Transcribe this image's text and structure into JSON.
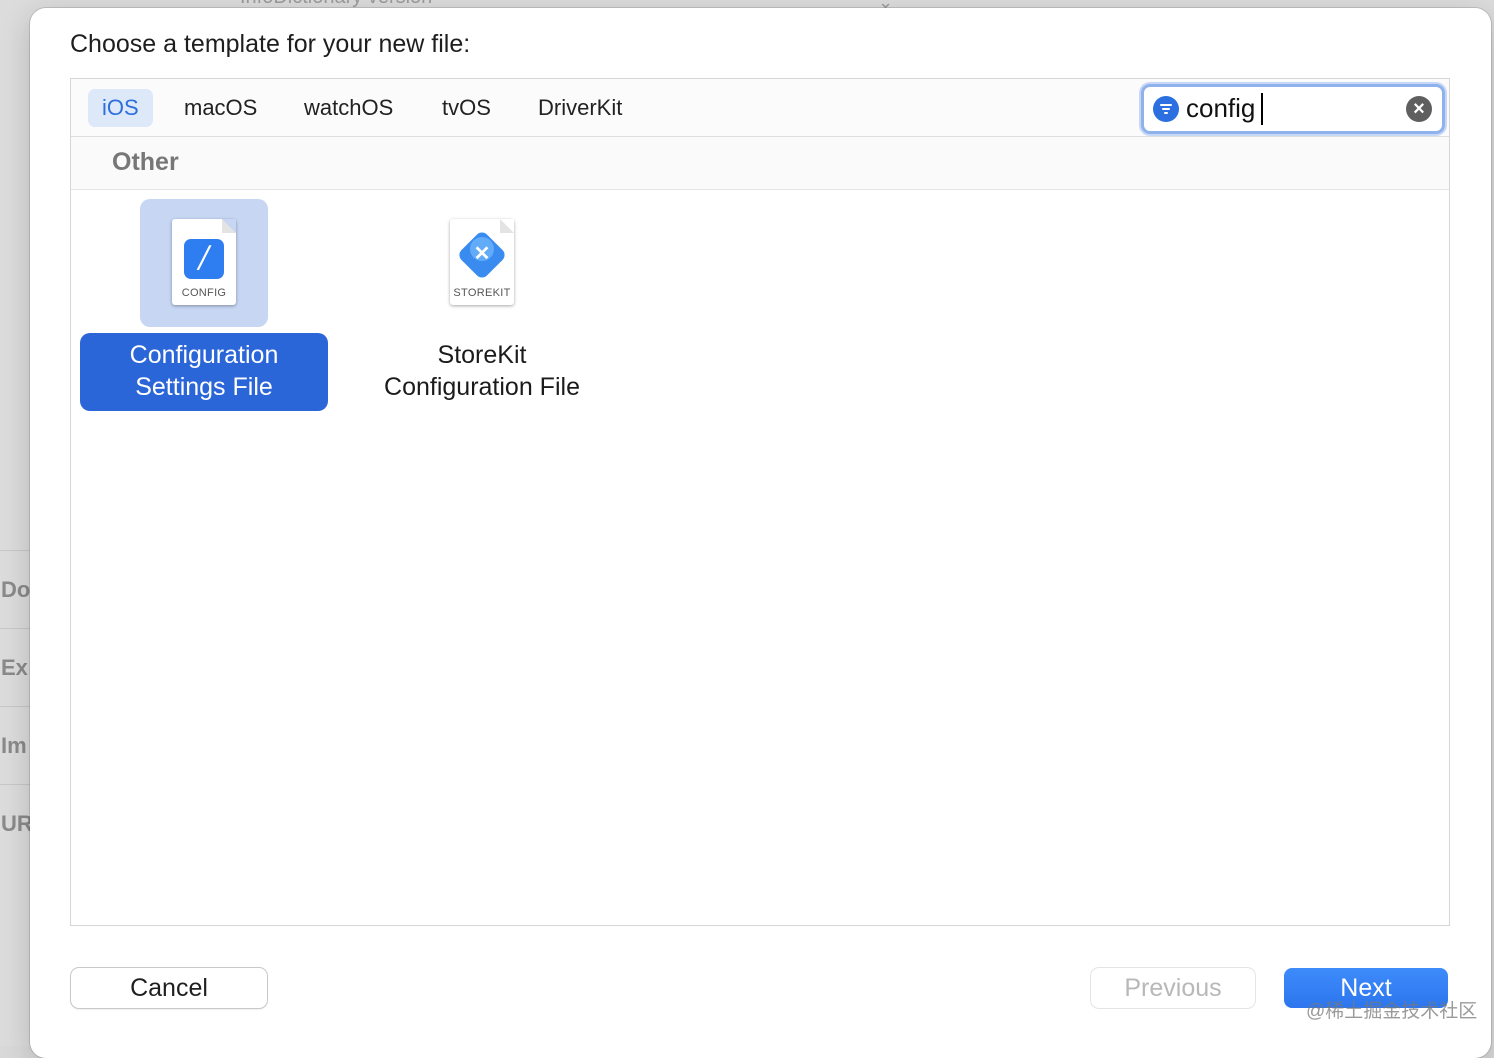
{
  "background": {
    "top_text": "InfoDictionary version",
    "sidebar_items": [
      "Do",
      "Ex",
      "Im",
      "UR"
    ]
  },
  "dialog": {
    "title": "Choose a template for your new file:",
    "platform_tabs": [
      {
        "label": "iOS",
        "selected": true
      },
      {
        "label": "macOS",
        "selected": false
      },
      {
        "label": "watchOS",
        "selected": false
      },
      {
        "label": "tvOS",
        "selected": false
      },
      {
        "label": "DriverKit",
        "selected": false
      }
    ],
    "search": {
      "value": "config",
      "filter_icon": "filter-icon",
      "clear_icon": "clear-icon"
    },
    "section": "Other",
    "templates": [
      {
        "name_line1": "Configuration",
        "name_line2": "Settings File",
        "badge": "CONFIG",
        "icon": "config-file-icon",
        "selected": true
      },
      {
        "name_line1": "StoreKit",
        "name_line2": "Configuration File",
        "badge": "STOREKIT",
        "icon": "storekit-file-icon",
        "selected": false
      }
    ],
    "buttons": {
      "cancel": "Cancel",
      "previous": "Previous",
      "next": "Next"
    }
  },
  "watermark": "@稀土掘金技术社区",
  "colors": {
    "accent": "#2b66d9",
    "tab_selected_bg": "#dde8f8",
    "tab_selected_text": "#2f6fdd"
  }
}
